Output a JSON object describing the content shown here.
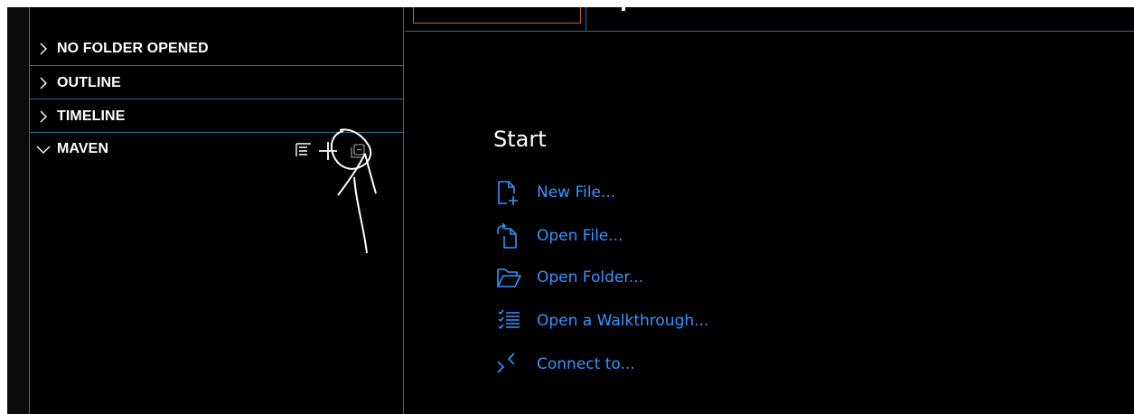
{
  "sidebar": {
    "sections": [
      {
        "title": "NO FOLDER OPENED",
        "expanded": false
      },
      {
        "title": "OUTLINE",
        "expanded": false
      },
      {
        "title": "TIMELINE",
        "expanded": false
      },
      {
        "title": "MAVEN",
        "expanded": true
      }
    ],
    "maven_actions": [
      "filter-icon",
      "add-icon",
      "collapse-all-icon"
    ]
  },
  "start": {
    "title": "Start",
    "items": [
      {
        "label": "New File...",
        "icon": "new-file-icon"
      },
      {
        "label": "Open File...",
        "icon": "open-file-icon"
      },
      {
        "label": "Open Folder...",
        "icon": "open-folder-icon"
      },
      {
        "label": "Open a Walkthrough...",
        "icon": "walkthrough-icon"
      },
      {
        "label": "Connect to...",
        "icon": "remote-connect-icon"
      }
    ]
  },
  "colors": {
    "background": "#000000",
    "border": "#2f6e8a",
    "link": "#3794ff",
    "text": "#ffffff",
    "tab_border": "#c26a2e"
  }
}
